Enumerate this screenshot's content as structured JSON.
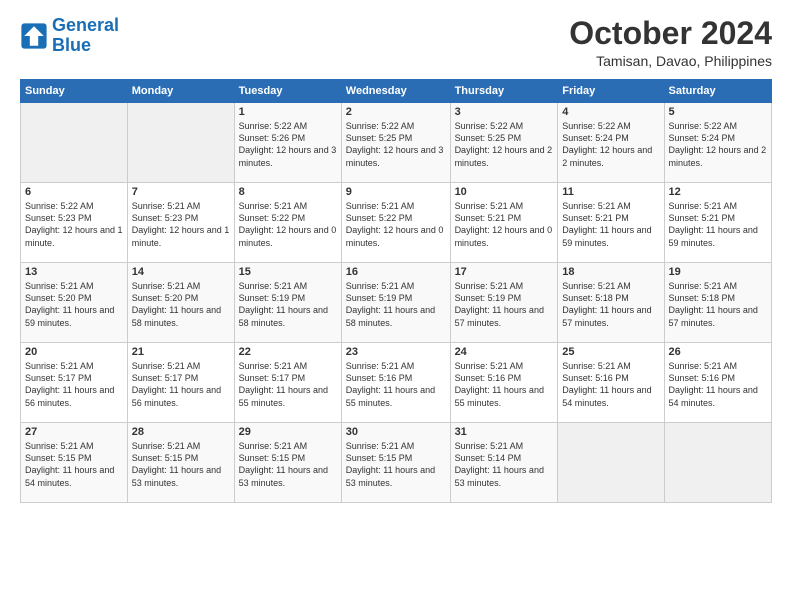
{
  "logo": {
    "line1": "General",
    "line2": "Blue"
  },
  "title": "October 2024",
  "subtitle": "Tamisan, Davao, Philippines",
  "weekdays": [
    "Sunday",
    "Monday",
    "Tuesday",
    "Wednesday",
    "Thursday",
    "Friday",
    "Saturday"
  ],
  "weeks": [
    [
      {
        "day": "",
        "detail": ""
      },
      {
        "day": "",
        "detail": ""
      },
      {
        "day": "1",
        "detail": "Sunrise: 5:22 AM\nSunset: 5:26 PM\nDaylight: 12 hours\nand 3 minutes."
      },
      {
        "day": "2",
        "detail": "Sunrise: 5:22 AM\nSunset: 5:25 PM\nDaylight: 12 hours\nand 3 minutes."
      },
      {
        "day": "3",
        "detail": "Sunrise: 5:22 AM\nSunset: 5:25 PM\nDaylight: 12 hours\nand 2 minutes."
      },
      {
        "day": "4",
        "detail": "Sunrise: 5:22 AM\nSunset: 5:24 PM\nDaylight: 12 hours\nand 2 minutes."
      },
      {
        "day": "5",
        "detail": "Sunrise: 5:22 AM\nSunset: 5:24 PM\nDaylight: 12 hours\nand 2 minutes."
      }
    ],
    [
      {
        "day": "6",
        "detail": "Sunrise: 5:22 AM\nSunset: 5:23 PM\nDaylight: 12 hours\nand 1 minute."
      },
      {
        "day": "7",
        "detail": "Sunrise: 5:21 AM\nSunset: 5:23 PM\nDaylight: 12 hours\nand 1 minute."
      },
      {
        "day": "8",
        "detail": "Sunrise: 5:21 AM\nSunset: 5:22 PM\nDaylight: 12 hours\nand 0 minutes."
      },
      {
        "day": "9",
        "detail": "Sunrise: 5:21 AM\nSunset: 5:22 PM\nDaylight: 12 hours\nand 0 minutes."
      },
      {
        "day": "10",
        "detail": "Sunrise: 5:21 AM\nSunset: 5:21 PM\nDaylight: 12 hours\nand 0 minutes."
      },
      {
        "day": "11",
        "detail": "Sunrise: 5:21 AM\nSunset: 5:21 PM\nDaylight: 11 hours\nand 59 minutes."
      },
      {
        "day": "12",
        "detail": "Sunrise: 5:21 AM\nSunset: 5:21 PM\nDaylight: 11 hours\nand 59 minutes."
      }
    ],
    [
      {
        "day": "13",
        "detail": "Sunrise: 5:21 AM\nSunset: 5:20 PM\nDaylight: 11 hours\nand 59 minutes."
      },
      {
        "day": "14",
        "detail": "Sunrise: 5:21 AM\nSunset: 5:20 PM\nDaylight: 11 hours\nand 58 minutes."
      },
      {
        "day": "15",
        "detail": "Sunrise: 5:21 AM\nSunset: 5:19 PM\nDaylight: 11 hours\nand 58 minutes."
      },
      {
        "day": "16",
        "detail": "Sunrise: 5:21 AM\nSunset: 5:19 PM\nDaylight: 11 hours\nand 58 minutes."
      },
      {
        "day": "17",
        "detail": "Sunrise: 5:21 AM\nSunset: 5:19 PM\nDaylight: 11 hours\nand 57 minutes."
      },
      {
        "day": "18",
        "detail": "Sunrise: 5:21 AM\nSunset: 5:18 PM\nDaylight: 11 hours\nand 57 minutes."
      },
      {
        "day": "19",
        "detail": "Sunrise: 5:21 AM\nSunset: 5:18 PM\nDaylight: 11 hours\nand 57 minutes."
      }
    ],
    [
      {
        "day": "20",
        "detail": "Sunrise: 5:21 AM\nSunset: 5:17 PM\nDaylight: 11 hours\nand 56 minutes."
      },
      {
        "day": "21",
        "detail": "Sunrise: 5:21 AM\nSunset: 5:17 PM\nDaylight: 11 hours\nand 56 minutes."
      },
      {
        "day": "22",
        "detail": "Sunrise: 5:21 AM\nSunset: 5:17 PM\nDaylight: 11 hours\nand 55 minutes."
      },
      {
        "day": "23",
        "detail": "Sunrise: 5:21 AM\nSunset: 5:16 PM\nDaylight: 11 hours\nand 55 minutes."
      },
      {
        "day": "24",
        "detail": "Sunrise: 5:21 AM\nSunset: 5:16 PM\nDaylight: 11 hours\nand 55 minutes."
      },
      {
        "day": "25",
        "detail": "Sunrise: 5:21 AM\nSunset: 5:16 PM\nDaylight: 11 hours\nand 54 minutes."
      },
      {
        "day": "26",
        "detail": "Sunrise: 5:21 AM\nSunset: 5:16 PM\nDaylight: 11 hours\nand 54 minutes."
      }
    ],
    [
      {
        "day": "27",
        "detail": "Sunrise: 5:21 AM\nSunset: 5:15 PM\nDaylight: 11 hours\nand 54 minutes."
      },
      {
        "day": "28",
        "detail": "Sunrise: 5:21 AM\nSunset: 5:15 PM\nDaylight: 11 hours\nand 53 minutes."
      },
      {
        "day": "29",
        "detail": "Sunrise: 5:21 AM\nSunset: 5:15 PM\nDaylight: 11 hours\nand 53 minutes."
      },
      {
        "day": "30",
        "detail": "Sunrise: 5:21 AM\nSunset: 5:15 PM\nDaylight: 11 hours\nand 53 minutes."
      },
      {
        "day": "31",
        "detail": "Sunrise: 5:21 AM\nSunset: 5:14 PM\nDaylight: 11 hours\nand 53 minutes."
      },
      {
        "day": "",
        "detail": ""
      },
      {
        "day": "",
        "detail": ""
      }
    ]
  ]
}
